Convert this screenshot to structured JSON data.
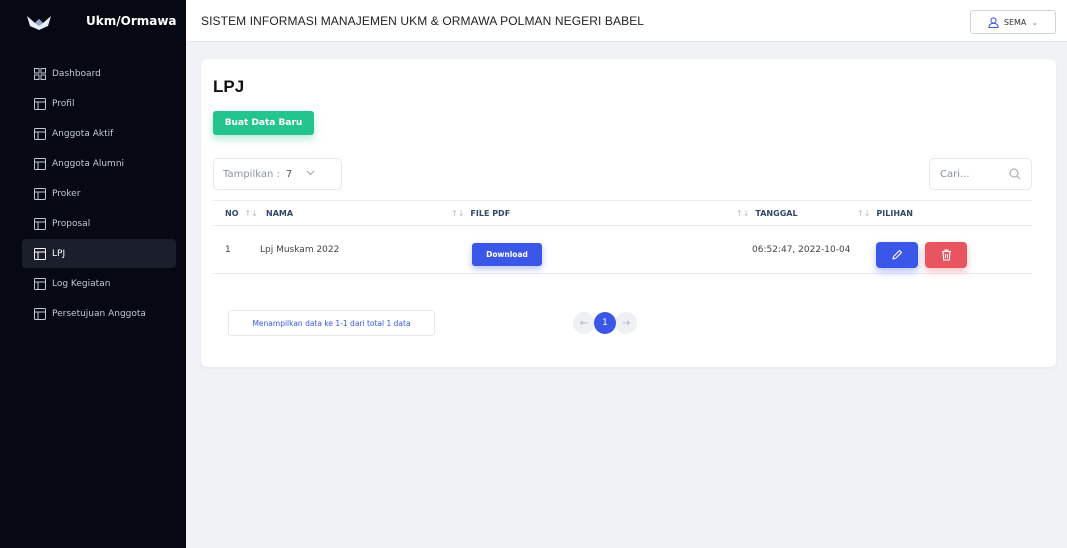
{
  "brand": {
    "name": "Ukm/Ormawa"
  },
  "sidebar": {
    "items": [
      {
        "label": "Dashboard",
        "icon": "grid-icon",
        "active": false
      },
      {
        "label": "Profil",
        "icon": "table-icon",
        "active": false
      },
      {
        "label": "Anggota Aktif",
        "icon": "table-icon",
        "active": false
      },
      {
        "label": "Anggota Alumni",
        "icon": "table-icon",
        "active": false
      },
      {
        "label": "Proker",
        "icon": "table-icon",
        "active": false
      },
      {
        "label": "Proposal",
        "icon": "table-icon",
        "active": false
      },
      {
        "label": "LPJ",
        "icon": "table-icon",
        "active": true
      },
      {
        "label": "Log Kegiatan",
        "icon": "table-icon",
        "active": false
      },
      {
        "label": "Persetujuan Anggota",
        "icon": "table-icon",
        "active": false
      }
    ]
  },
  "header": {
    "title": "SISTEM INFORMASI MANAJEMEN UKM & ORMAWA POLMAN NEGERI BABEL",
    "user_label": "SEMA",
    "user_chevron": "⌄"
  },
  "page": {
    "title": "LPJ",
    "new_button": "Buat Data Baru",
    "show_label": "Tampilkan :",
    "show_value": "7",
    "search_placeholder": "Cari..."
  },
  "table": {
    "columns": [
      "NO",
      "NAMA",
      "FILE PDF",
      "TANGGAL",
      "PILIHAN"
    ],
    "sort_glyph": "↑↓",
    "rows": [
      {
        "no": "1",
        "nama": "Lpj Muskam 2022",
        "file_button": "Download",
        "tanggal": "06:52:47, 2022-10-04"
      }
    ]
  },
  "footer": {
    "info": "Menampilkan data ke 1-1 dari total 1 data",
    "prev": "←",
    "current_page": "1",
    "next": "→"
  },
  "colors": {
    "sidebar_bg": "#060913",
    "primary": "#3a57e8",
    "success": "#24c48e",
    "danger": "#e85560"
  }
}
